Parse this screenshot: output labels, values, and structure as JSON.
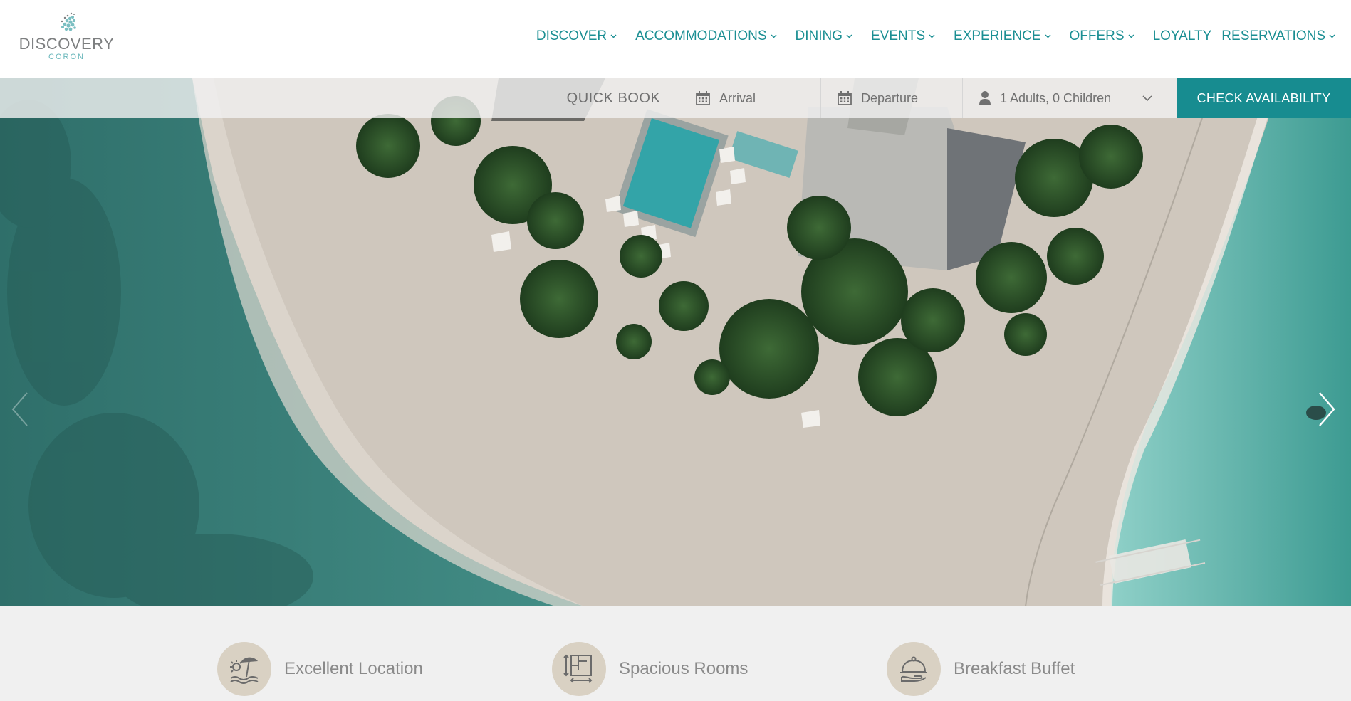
{
  "logo": {
    "name": "DISCOVERY",
    "sub": "CORON"
  },
  "nav": [
    {
      "label": "DISCOVER",
      "dropdown": true
    },
    {
      "label": "ACCOMMODATIONS",
      "dropdown": true
    },
    {
      "label": "DINING",
      "dropdown": true
    },
    {
      "label": "EVENTS",
      "dropdown": true
    },
    {
      "label": "EXPERIENCE",
      "dropdown": true
    },
    {
      "label": "OFFERS",
      "dropdown": true
    },
    {
      "label": "LOYALTY",
      "dropdown": false
    },
    {
      "label": "RESERVATIONS",
      "dropdown": true
    }
  ],
  "quickbook": {
    "label": "QUICK BOOK",
    "arrival_placeholder": "Arrival",
    "departure_placeholder": "Departure",
    "guests": "1 Adults, 0 Children",
    "button": "CHECK AVAILABILITY"
  },
  "features": [
    {
      "label": "Excellent Location",
      "icon": "beach-umbrella-icon"
    },
    {
      "label": "Spacious Rooms",
      "icon": "room-size-icon"
    },
    {
      "label": "Breakfast Buffet",
      "icon": "serving-cloche-icon"
    }
  ],
  "colors": {
    "accent": "#178c90",
    "nav_text": "#1b8f93",
    "feature_circle": "#d9d1c3",
    "sand": "#cfc7bd"
  }
}
